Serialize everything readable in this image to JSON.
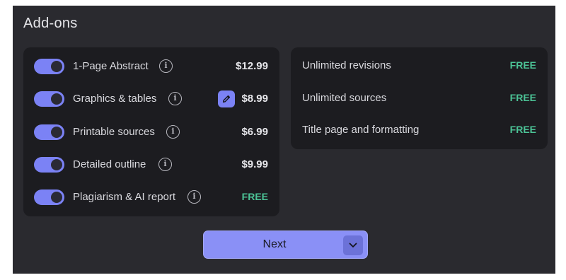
{
  "title": "Add-ons",
  "colors": {
    "panel_bg": "#2a2a2f",
    "card_bg": "#1c1c20",
    "accent": "#7b82f5",
    "free": "#4cc497"
  },
  "paid_addons": [
    {
      "label": "1-Page Abstract",
      "price": "$12.99",
      "enabled": true,
      "icon": "info-icon"
    },
    {
      "label": "Graphics & tables",
      "price": "$8.99",
      "enabled": true,
      "icon": "info-icon",
      "action_icon": "pencil-icon"
    },
    {
      "label": "Printable sources",
      "price": "$6.99",
      "enabled": true,
      "icon": "info-icon"
    },
    {
      "label": "Detailed outline",
      "price": "$9.99",
      "enabled": true,
      "icon": "info-icon"
    },
    {
      "label": "Plagiarism & AI report",
      "price": "FREE",
      "enabled": true,
      "icon": "info-icon"
    }
  ],
  "free_features": [
    {
      "label": "Unlimited revisions",
      "price": "FREE"
    },
    {
      "label": "Unlimited sources",
      "price": "FREE"
    },
    {
      "label": "Title page and formatting",
      "price": "FREE"
    }
  ],
  "next_button": {
    "label": "Next",
    "icon": "chevron-down-icon"
  }
}
